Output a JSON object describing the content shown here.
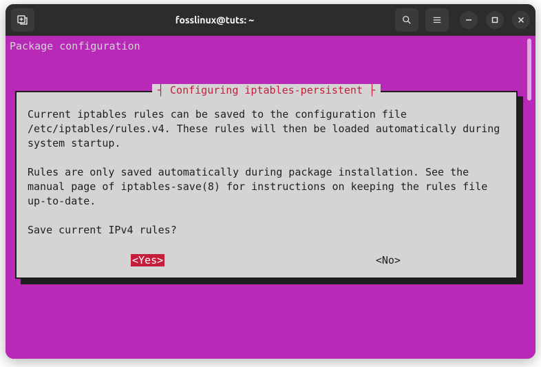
{
  "titlebar": {
    "title": "fosslinux@tuts: ~"
  },
  "terminal": {
    "header_label": "Package configuration"
  },
  "dialog": {
    "title": "Configuring iptables-persistent",
    "paragraph1": "Current iptables rules can be saved to the configuration file /etc/iptables/rules.v4. These rules will then be loaded automatically during system startup.",
    "paragraph2": "Rules are only saved automatically during package installation. See the manual page of iptables-save(8) for instructions on keeping the rules file up-to-date.",
    "question": "Save current IPv4 rules?",
    "yes_label": "<Yes>",
    "no_label": "<No>"
  }
}
